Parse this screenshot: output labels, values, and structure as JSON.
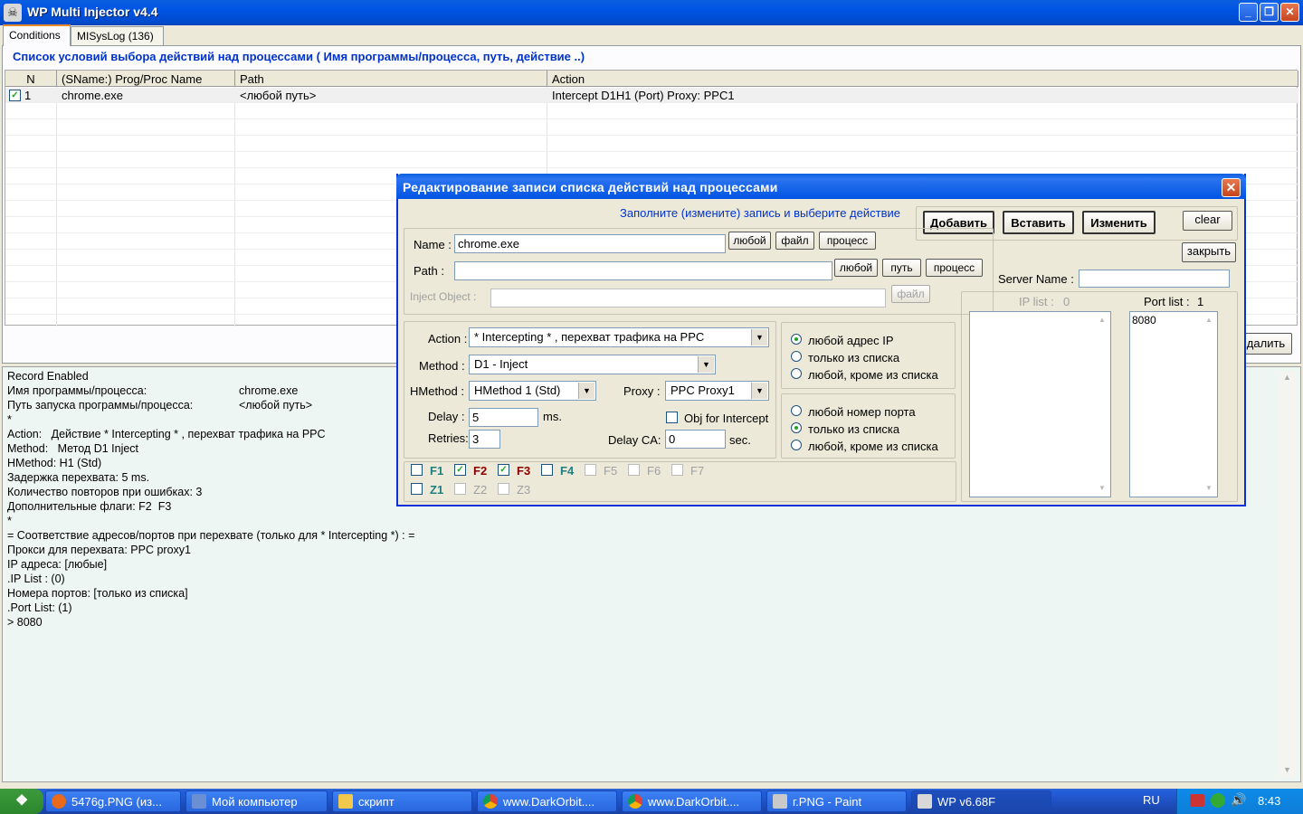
{
  "window": {
    "title": "WP Multi Injector v4.4",
    "min": "_",
    "max": "❐",
    "close": "✕",
    "icon": "skull-icon"
  },
  "tabs": [
    "Conditions",
    "MISysLog (136)"
  ],
  "heading": "Список условий выбора действий над процессами ( Имя программы/процесса,  путь, действие ..)",
  "grid": {
    "columns": [
      "N",
      "(SName:) Prog/Proc Name",
      "Path",
      "Action"
    ],
    "rows": [
      {
        "n": "1",
        "checked": "✓",
        "name": "chrome.exe",
        "path": "<любой путь>",
        "action": "Intercept D1H1 (Port)  Proxy: PPC1"
      }
    ]
  },
  "delete_button": "далить",
  "log": [
    "Record Enabled",
    "Имя программы/процесса:",
    "Путь запуска программы/процесса:",
    "*",
    "Action:   Действие * Intercepting * , перехват трафика на PPC",
    "Method:   Метод D1 Inject",
    "HMethod: H1 (Std)",
    "Задержка перехвата: 5 ms.",
    "Количество повторов при ошибках: 3",
    "Дополнительные флаги: F2  F3",
    "*",
    "= Соответствие адресов/портов при перехвате (только для * Intercepting *) : =",
    "Прокси для перехвата: PPC proxy1",
    "IP адреса: [любые]",
    ".IP List : (0)",
    "Номера портов: [только из списка]",
    ".Port List: (1)",
    "> 8080"
  ],
  "log_values": {
    "proc": "chrome.exe",
    "path": "<любой путь>"
  },
  "dialog": {
    "title": "Редактирование записи списка действий над процессами",
    "close": "✕",
    "hint": "Заполните (измените) запись и выберите действие",
    "btn_add": "Добавить",
    "btn_insert": "Вставить",
    "btn_change": "Изменить",
    "btn_clear": "clear",
    "btn_close": "закрыть",
    "name_label": "Name :",
    "name_value": "chrome.exe",
    "btn_any": "любой",
    "btn_file": "файл",
    "btn_process": "процесс",
    "path_label": "Path :",
    "path_value": "",
    "btn_any2": "любой",
    "btn_path": "путь",
    "btn_process2": "процесс",
    "inject_label": "Inject Object :",
    "inject_value": "",
    "btn_file2": "файл",
    "server_label": "Server Name :",
    "server_value": "",
    "action_label": "Action :",
    "action_value": "* Intercepting * , перехват трафика на PPC",
    "method_label": "Method :",
    "method_value": "D1 - Inject",
    "hmethod_label": "HMethod :",
    "hmethod_value": "HMethod 1 (Std)",
    "proxy_label": "Proxy :",
    "proxy_value": "PPC Proxy1",
    "delay_label": "Delay :",
    "delay_value": "5",
    "delay_unit": "ms.",
    "retries_label": "Retries:",
    "retries_value": "3",
    "obj_intercept": "Obj for Intercept",
    "delayca_label": "Delay CA:",
    "delayca_value": "0",
    "delayca_unit": "sec.",
    "ip_opts": [
      "любой адрес IP",
      "только из списка",
      "любой, кроме из списка"
    ],
    "port_opts": [
      "любой номер порта",
      "только из списка",
      "любой, кроме из списка"
    ],
    "flags": [
      "F1",
      "F2",
      "F3",
      "F4",
      "F5",
      "F6",
      "F7"
    ],
    "zflags": [
      "Z1",
      "Z2",
      "Z3"
    ],
    "checkmark": "✓",
    "iplist_label": "IP list :",
    "iplist_count": "0",
    "portlist_label": "Port list :",
    "portlist_count": "1",
    "ports": [
      "8080"
    ],
    "combo_arrow": "▼",
    "scroll_up": "▲",
    "scroll_down": "▼"
  },
  "taskbar": {
    "items": [
      "5476g.PNG (из...",
      "Мой компьютер",
      "скрипт",
      "www.DarkOrbit....",
      "www.DarkOrbit....",
      "г.PNG - Paint",
      "WP v6.68F"
    ],
    "lang": "RU",
    "clock": "8:43"
  }
}
